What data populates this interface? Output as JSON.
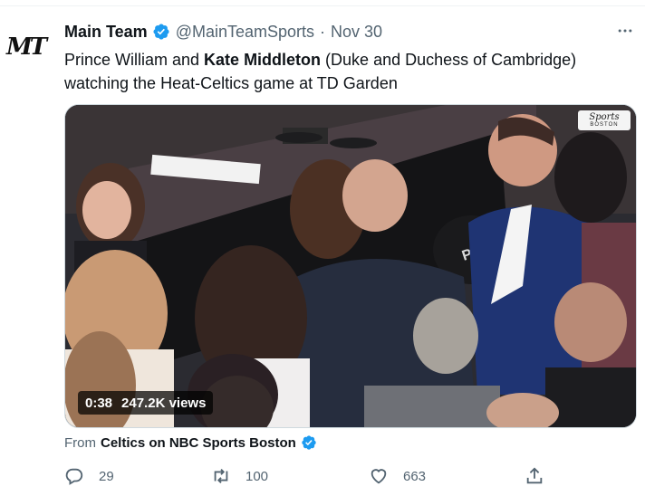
{
  "author": {
    "display_name": "Main Team",
    "handle": "@MainTeamSports",
    "separator": "·",
    "date": "Nov 30",
    "avatar_text": "MT"
  },
  "tweet": {
    "text_part1": "Prince William and ",
    "text_bold": "Kate Middleton",
    "text_part2": " (Duke and Duchess of Cambridge) watching the Heat-Celtics game at TD Garden"
  },
  "media": {
    "duration": "0:38",
    "views": "247.2K views",
    "broadcaster_logo_line1": "Sports",
    "broadcaster_logo_line2": "BOSTON",
    "seat_sign": "Putna"
  },
  "source": {
    "prefix": "From",
    "name": "Celtics on NBC Sports Boston"
  },
  "actions": {
    "reply_count": "29",
    "retweet_count": "100",
    "like_count": "663"
  },
  "colors": {
    "verified_blue": "#1d9bf0",
    "secondary_text": "#536471",
    "primary_text": "#0f1419"
  },
  "icons": [
    "verified-badge-icon",
    "more-icon",
    "reply-icon",
    "retweet-icon",
    "like-icon",
    "share-icon"
  ]
}
